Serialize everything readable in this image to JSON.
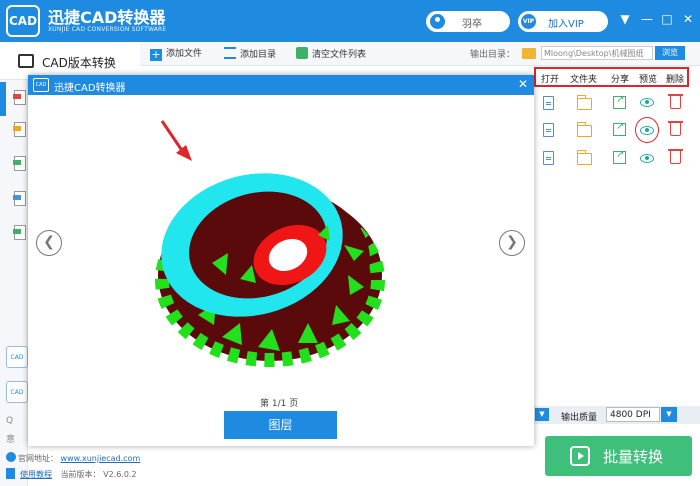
{
  "app": {
    "title": "迅捷CAD转换器",
    "subtitle": "XUNJIE CAD CONVERSION SOFTWARE",
    "logo_text": "CAD",
    "user_name": "羽卒",
    "vip_badge": "VIP",
    "vip_label": "加入VIP",
    "window_controls": [
      "gear-icon",
      "minimize-icon",
      "maximize-icon",
      "close-icon"
    ]
  },
  "sidebar": {
    "title": "CAD版本转换",
    "bottom_text": [
      "Q",
      "意"
    ],
    "file_icon_tags": [
      "#e0453f",
      "#f0a81c",
      "#3db06a",
      "#4a90d9",
      "#3db06a"
    ]
  },
  "toolbar": {
    "add_file": "添加文件",
    "add_folder": "添加目录",
    "clear_list": "清空文件列表",
    "output_label": "输出目录：",
    "output_path": "Mloong\\Desktop\\机械图纸",
    "browse": "浏览"
  },
  "actions": {
    "headers": [
      "打开",
      "文件夹",
      "分享",
      "预览",
      "删除"
    ],
    "rows": 3
  },
  "quality": {
    "label": "输出质量",
    "value": "4800 DPI"
  },
  "batch_button": "批量转换",
  "footer": {
    "website_label": "官网地址：",
    "website_url": "www.xunjiecad.com",
    "tutorial": "使用教程",
    "version_label": "当前版本：",
    "version": "V2.6.0.2"
  },
  "preview": {
    "title": "迅捷CAD转换器",
    "logo_text": "CAD",
    "page_info": "第 1/1 页",
    "layer_button": "图层"
  },
  "colors": {
    "brand_blue": "#1e8ae0",
    "accent_red": "#e0242a",
    "batch_green": "#3fc07a",
    "model_cyan": "#21e6ee",
    "model_red": "#f01616",
    "model_maroon": "#5a0a0a",
    "model_green": "#22e01c"
  }
}
